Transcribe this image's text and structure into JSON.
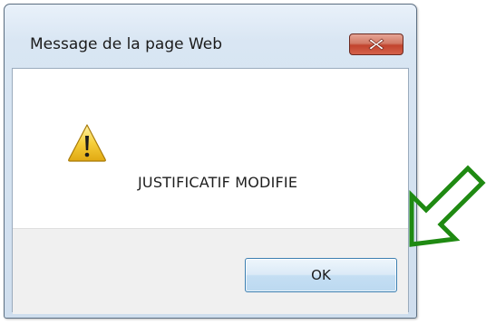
{
  "dialog": {
    "title": "Message de la page Web",
    "close_icon": "close-icon",
    "message": "JUSTIFICATIF MODIFIE",
    "icon": "warning-icon",
    "ok_label": "OK"
  },
  "annotation": {
    "icon": "arrow-pointer-icon",
    "color": "#1f8a12"
  },
  "colors": {
    "close_button": "#c7432d",
    "ok_button_border": "#3c7fb1"
  }
}
